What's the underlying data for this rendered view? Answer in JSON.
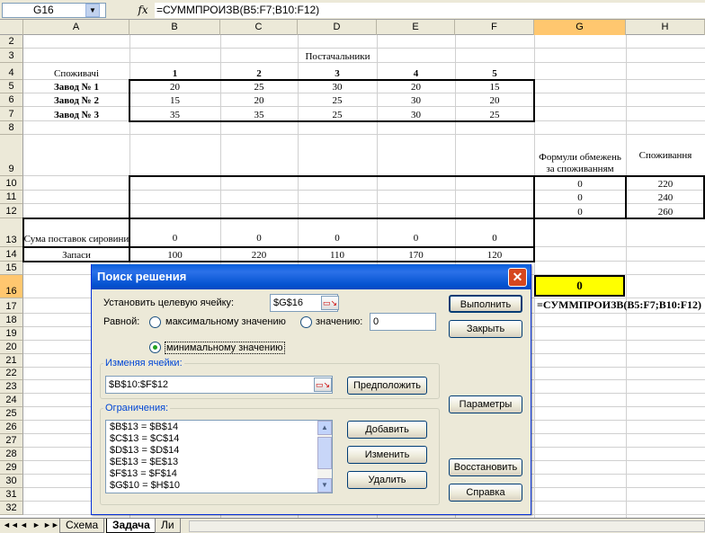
{
  "formula_bar": {
    "name_box": "G16",
    "fx": "fx",
    "formula": "=СУММПРОИЗВ(B5:F7;B10:F12)"
  },
  "columns": [
    "A",
    "B",
    "C",
    "D",
    "E",
    "F",
    "G",
    "H"
  ],
  "rows": [
    "2",
    "3",
    "4",
    "5",
    "6",
    "7",
    "8",
    "9",
    "10",
    "11",
    "12",
    "13",
    "14",
    "15",
    "16",
    "17",
    "18",
    "19",
    "20",
    "21",
    "22",
    "23",
    "24",
    "25",
    "26",
    "27",
    "28",
    "29",
    "30",
    "31",
    "32"
  ],
  "sheet": {
    "suppliers_header": "Постачальники",
    "consumers_label": "Споживачі",
    "supplier_nums": [
      "1",
      "2",
      "3",
      "4",
      "5"
    ],
    "plants": [
      "Завод № 1",
      "Завод № 2",
      "Завод № 3"
    ],
    "costs": [
      [
        "20",
        "25",
        "30",
        "20",
        "15"
      ],
      [
        "15",
        "20",
        "25",
        "30",
        "20"
      ],
      [
        "35",
        "35",
        "25",
        "30",
        "25"
      ]
    ],
    "constraints_formula_header": "Формули обмежень за споживанням",
    "consumption_header": "Споживання",
    "g_values": [
      "0",
      "0",
      "0"
    ],
    "consumption": [
      "220",
      "240",
      "260"
    ],
    "sum_label": "Сума поставок сировини",
    "sums": [
      "0",
      "0",
      "0",
      "0",
      "0"
    ],
    "stock_label": "Запаси",
    "stocks": [
      "100",
      "220",
      "110",
      "170",
      "120"
    ],
    "g16_value": "0",
    "g16_formula": "=СУММПРОИЗВ(B5:F7;B10:F12)"
  },
  "tabs": {
    "nav": [
      "◄◄",
      "◄",
      "►",
      "►►"
    ],
    "items": [
      "Схема",
      "Задача",
      "Ли"
    ]
  },
  "dialog": {
    "title": "Поиск решения",
    "set_target_label": "Установить целевую ячейку:",
    "target_value": "$G$16",
    "equal_label": "Равной:",
    "opt_max": "максимальному значению",
    "opt_value": "значению:",
    "value_input": "0",
    "opt_min": "минимальному значению",
    "changing_label": "Изменяя ячейки:",
    "changing_value": "$B$10:$F$12",
    "guess_button": "Предположить",
    "constraints_label": "Ограничения:",
    "constraints": [
      "$B$13 = $B$14",
      "$C$13 = $C$14",
      "$D$13 = $D$14",
      "$E$13 = $E$13",
      "$F$13 = $F$14",
      "$G$10 = $H$10"
    ],
    "add_button": "Добавить",
    "change_button": "Изменить",
    "delete_button": "Удалить",
    "solve_button": "Выполнить",
    "close_button": "Закрыть",
    "options_button": "Параметры",
    "reset_button": "Восстановить",
    "help_button": "Справка"
  }
}
